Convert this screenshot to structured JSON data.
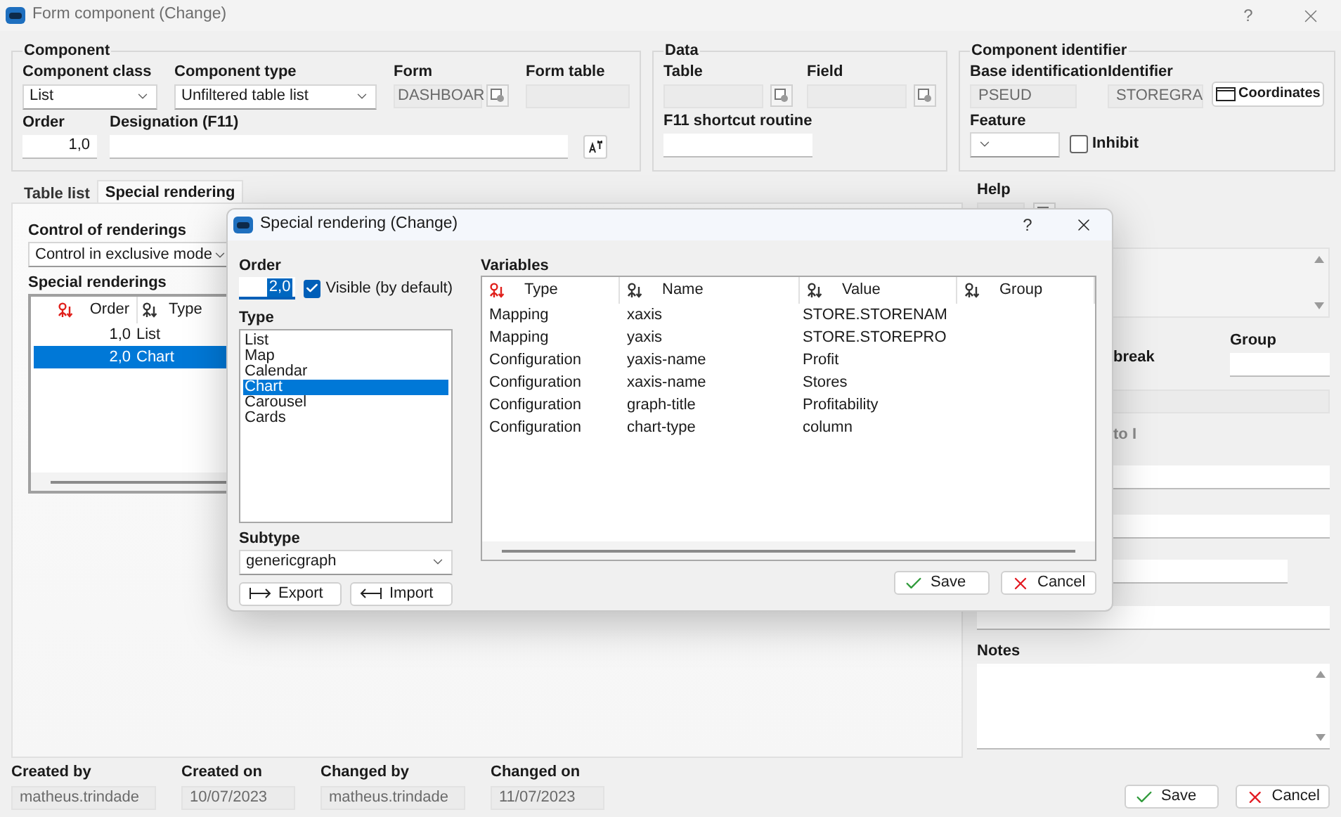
{
  "window": {
    "title": "Form component (Change)",
    "help": "?"
  },
  "component": {
    "title": "Component",
    "class": {
      "label": "Component class",
      "value": "List"
    },
    "type": {
      "label": "Component type",
      "value": "Unfiltered table list"
    },
    "form": {
      "label": "Form",
      "value": "DASHBOAR"
    },
    "form_table": {
      "label": "Form table"
    },
    "order": {
      "label": "Order",
      "value": "1,0"
    },
    "designation": {
      "label": "Designation (F11)"
    }
  },
  "data": {
    "title": "Data",
    "table": {
      "label": "Table"
    },
    "field": {
      "label": "Field"
    },
    "shortcut": {
      "label": "F11 shortcut routine"
    }
  },
  "identifier": {
    "title": "Component identifier",
    "base": {
      "label": "Base identification",
      "value": "PSEUD"
    },
    "identifier": {
      "label": "Identifier",
      "value": "STOREGRA"
    },
    "coordinates": "Coordinates",
    "feature": {
      "label": "Feature"
    },
    "inhibit": {
      "label": "Inhibit",
      "checked": false
    }
  },
  "tabs": [
    {
      "label": "Table list",
      "selected": false
    },
    {
      "label": "Special rendering",
      "selected": true
    }
  ],
  "renderings": {
    "control_label": "Control of renderings",
    "control_value": "Control in exclusive mode",
    "list_label": "Special renderings",
    "columns": [
      {
        "label": "Order",
        "sorted": true
      },
      {
        "label": "Type",
        "sorted": false
      }
    ],
    "rows": [
      {
        "order": "1,0",
        "type": "List",
        "selected": false
      },
      {
        "order": "2,0",
        "type": "Chart",
        "selected": true
      }
    ]
  },
  "right_panel": {
    "help_label": "Help",
    "group_label": "Group",
    "break_text": "break",
    "to_text": "to I",
    "notes_label": "Notes"
  },
  "audit": [
    {
      "label": "Created by",
      "value": "matheus.trindade"
    },
    {
      "label": "Created on",
      "value": "10/07/2023"
    },
    {
      "label": "Changed by",
      "value": "matheus.trindade"
    },
    {
      "label": "Changed on",
      "value": "11/07/2023"
    }
  ],
  "buttons": [
    {
      "label": "Save",
      "kind": "save"
    },
    {
      "label": "Cancel",
      "kind": "cancel"
    }
  ],
  "dialog": {
    "title": "Special rendering (Change)",
    "help": "?",
    "order_label": "Order",
    "order_value": "2,0",
    "visible": {
      "label": "Visible (by default)",
      "checked": true
    },
    "type_label": "Type",
    "types": [
      {
        "label": "List",
        "selected": false
      },
      {
        "label": "Map",
        "selected": false
      },
      {
        "label": "Calendar",
        "selected": false
      },
      {
        "label": "Chart",
        "selected": true
      },
      {
        "label": "Carousel",
        "selected": false
      },
      {
        "label": "Cards",
        "selected": false
      }
    ],
    "subtype_label": "Subtype",
    "subtype_value": "genericgraph",
    "actions": [
      {
        "label": "Export",
        "kind": "export"
      },
      {
        "label": "Import",
        "kind": "import"
      }
    ],
    "variables_label": "Variables",
    "columns": [
      {
        "label": "Type",
        "sorted": true
      },
      {
        "label": "Name",
        "sorted": false
      },
      {
        "label": "Value",
        "sorted": false
      },
      {
        "label": "Group",
        "sorted": false
      }
    ],
    "rows": [
      {
        "type": "Mapping",
        "name": "xaxis",
        "value": "STORE.STORENAM"
      },
      {
        "type": "Mapping",
        "name": "yaxis",
        "value": "STORE.STOREPRO"
      },
      {
        "type": "Configuration",
        "name": "yaxis-name",
        "value": "Profit"
      },
      {
        "type": "Configuration",
        "name": "xaxis-name",
        "value": "Stores"
      },
      {
        "type": "Configuration",
        "name": "graph-title",
        "value": "Profitability"
      },
      {
        "type": "Configuration",
        "name": "chart-type",
        "value": "column"
      }
    ],
    "buttons": [
      {
        "label": "Save",
        "kind": "save"
      },
      {
        "label": "Cancel",
        "kind": "cancel"
      }
    ]
  }
}
